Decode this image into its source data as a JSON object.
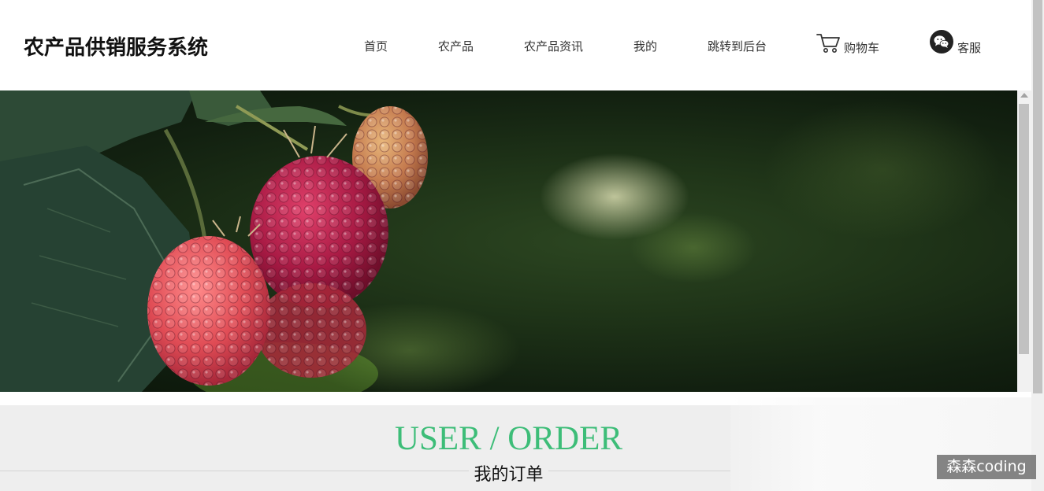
{
  "header": {
    "site_title": "农产品供销服务系统",
    "nav": {
      "home": "首页",
      "products": "农产品",
      "news": "农产品资讯",
      "mine": "我的",
      "admin": "跳转到后台",
      "cart": "购物车",
      "service": "客服"
    },
    "icons": {
      "cart": "shopping-cart-icon",
      "service": "wechat-icon"
    }
  },
  "banner": {
    "image": "raspberries-photo"
  },
  "order_section": {
    "en_title": "USER / ORDER",
    "cn_title": "我的订单"
  },
  "watermark": {
    "text": "森森coding"
  },
  "colors": {
    "accent_green": "#3dbd78",
    "section_bg": "#eeeeee",
    "title_text": "#111111"
  }
}
